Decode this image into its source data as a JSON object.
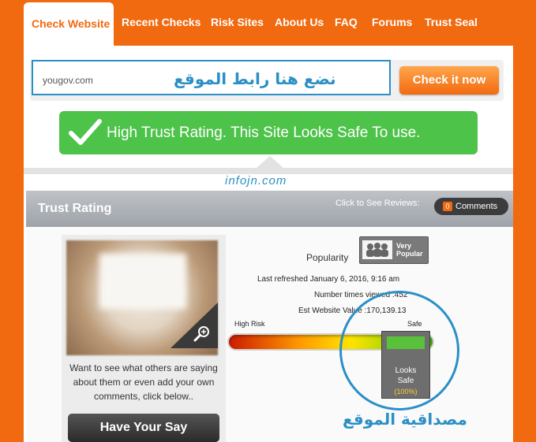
{
  "nav": {
    "items": [
      "Check Website",
      "Recent Checks",
      "Risk Sites",
      "About Us",
      "FAQ",
      "Forums",
      "Trust Seal"
    ],
    "active": "Check Website"
  },
  "search": {
    "value": "yougov.com",
    "overlay_arabic": "نضع هنا رابط الموقع",
    "button": "Check it now"
  },
  "trust_banner": {
    "text": "High Trust Rating. This Site Looks Safe To use."
  },
  "watermark": "infojn.com",
  "trust_rating": {
    "title": "Trust Rating",
    "click_reviews": "Click to See Reviews:",
    "comments_count": "0",
    "comments_label": "Comments",
    "want_text": "Want to see what others are saying about them or even add your own comments, click below..",
    "have_say": "Have Your Say",
    "popularity_label": "Popularity",
    "popularity_value_1": "Very",
    "popularity_value_2": "Popular",
    "last_refreshed": "Last refreshed January 6, 2016, 9:16 am",
    "times_viewed": "Number times viewed :452",
    "est_value": "Est Website Value :170,139.13",
    "scale_high_risk": "High Risk",
    "scale_safe": "Safe",
    "slider_line1": "Looks",
    "slider_line2": "Safe",
    "slider_pct": "(100%)",
    "arabic_caption": "مصداقية الموقع"
  },
  "colors": {
    "orange": "#f26a10",
    "blue": "#2a8fc6",
    "green": "#4ec34a"
  }
}
